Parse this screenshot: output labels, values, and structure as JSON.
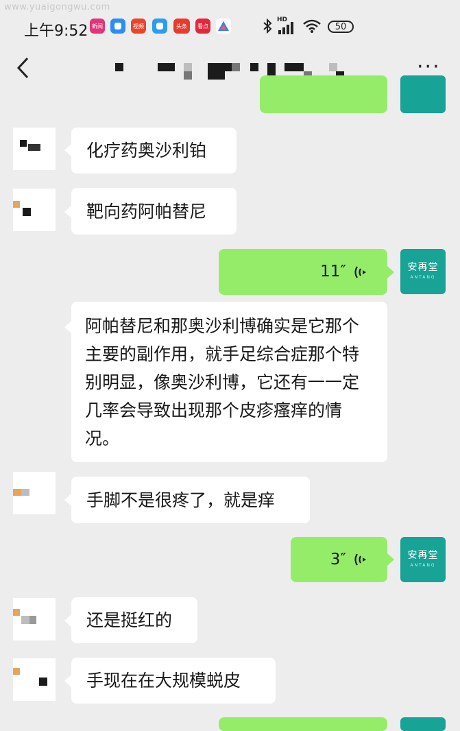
{
  "watermark": "www.yuaigongwu.com",
  "status_bar": {
    "time": "上午9:52",
    "app_icons": [
      {
        "name": "news-app-icon",
        "color": "#e0367a",
        "label": "新闻"
      },
      {
        "name": "blue-app-icon",
        "color": "#2b8ef0",
        "label": ""
      },
      {
        "name": "video-app-icon",
        "color": "#e8462c",
        "label": "视频"
      },
      {
        "name": "blue-app-2-icon",
        "color": "#2b9df0",
        "label": ""
      },
      {
        "name": "toutiao-app-icon",
        "color": "#e83b2f",
        "label": "头条"
      },
      {
        "name": "kandian-app-icon",
        "color": "#e2283d",
        "label": "看点"
      },
      {
        "name": "triangle-app-icon",
        "color": "#ffffff",
        "label": ""
      }
    ],
    "network_label": "HD",
    "battery": "50"
  },
  "nav": {
    "back_icon": "chevron-left-icon",
    "more_icon": "more-dots-icon",
    "more_label": "···"
  },
  "messages": [
    {
      "side": "out",
      "text": ""
    },
    {
      "side": "in",
      "text": "化疗药奥沙利铂"
    },
    {
      "side": "in",
      "text": "靶向药阿帕替尼"
    },
    {
      "side": "out",
      "voice": "11″"
    },
    {
      "side": "in",
      "text": "阿帕替尼和那奥沙利博确实是它那个主要的副作用，就手足综合症那个特别明显，像奥沙利博，它还有一一定几率会导致出现那个皮疹瘙痒的情况。"
    },
    {
      "side": "in",
      "text": "手脚不是很疼了，就是痒"
    },
    {
      "side": "out",
      "voice": "3″"
    },
    {
      "side": "in",
      "text": "还是挺红的"
    },
    {
      "side": "in",
      "text": "手现在在大规模蜕皮"
    }
  ],
  "avatar_out": {
    "title": "安再堂",
    "subtitle": "ANTANG"
  },
  "colors": {
    "background": "#ededed",
    "bubble_out": "#95ec69",
    "bubble_in": "#ffffff",
    "avatar_out": "#17a395"
  }
}
